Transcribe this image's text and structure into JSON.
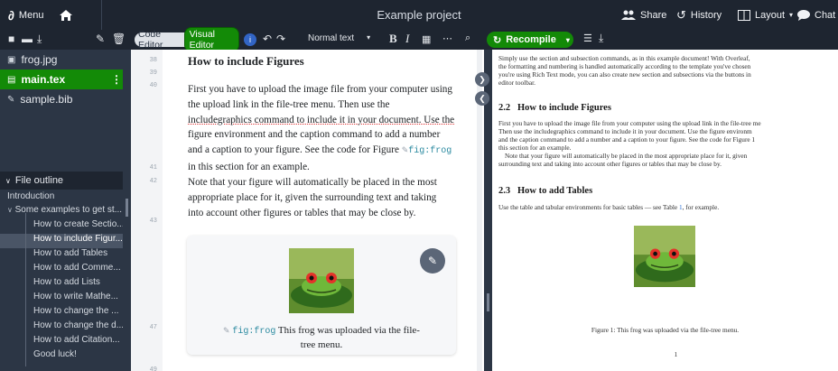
{
  "topbar": {
    "menu_label": "Menu",
    "project_title": "Example project",
    "share_label": "Share",
    "history_label": "History",
    "layout_label": "Layout",
    "chat_label": "Chat"
  },
  "files": [
    {
      "name": "frog.jpg",
      "icon": "image-icon"
    },
    {
      "name": "main.tex",
      "icon": "file-icon"
    },
    {
      "name": "sample.bib",
      "icon": "bib-icon"
    }
  ],
  "outline": {
    "title": "File outline",
    "items": [
      "Introduction",
      "Some examples to get st...",
      "How to create Sectio...",
      "How to include Figur...",
      "How to add Tables",
      "How to add Comme...",
      "How to add Lists",
      "How to write Mathe...",
      "How to change the ...",
      "How to change the d...",
      "How to add Citation...",
      "Good luck!"
    ]
  },
  "editor": {
    "code_editor_label": "Code Editor",
    "visual_editor_label": "Visual Editor",
    "style_select": "Normal text",
    "line_numbers": [
      "38",
      "39",
      "40",
      "41",
      "42",
      "43",
      "47",
      "49"
    ],
    "heading": "How to include Figures",
    "para1_l1": "First you have to upload the image file from your computer using",
    "para1_l2": "the upload link in the file-tree menu. Then use the",
    "para1_l3": "includegraphics command to include it in your document. Use the",
    "para1_l4": "figure environment and the caption command to add a number",
    "para1_l5": "and a caption to your figure. See the code for Figure",
    "para1_ref": "fig:frog",
    "para1_l6": "in this section for an example.",
    "para2_l1": "Note that your figure will automatically be placed in the most",
    "para2_l2": "appropriate place for it, given the surrounding text and taking",
    "para2_l3": "into account other figures or tables that may be close by.",
    "fig_label": "fig:frog",
    "fig_caption_l1": "This frog was uploaded via the file-",
    "fig_caption_l2": "tree menu."
  },
  "pdf": {
    "recompile_label": "Recompile",
    "intro_l1": "Simply use the section and subsection commands, as in this example document! With Overleaf,",
    "intro_l2": "the formatting and numbering is handled automatically according to the template you've chosen",
    "intro_l3": "you're using Rich Text mode, you can also create new section and subsections via the buttons in",
    "intro_l4": "editor toolbar.",
    "sec22_num": "2.2",
    "sec22_title": "How to include Figures",
    "p22_l1": "First you have to upload the image file from your computer using the upload link in the file-tree me",
    "p22_l2": "Then use the includegraphics command to include it in your document. Use the figure environm",
    "p22_l3": "and the caption command to add a number and a caption to your figure. See the code for Figure 1",
    "p22_l4": "this section for an example.",
    "p22_l5": "Note that your figure will automatically be placed in the most appropriate place for it, given",
    "p22_l6": "surrounding text and taking into account other figures or tables that may be close by.",
    "sec23_num": "2.3",
    "sec23_title": "How to add Tables",
    "p23_pre": "Use the table and tabular environments for basic tables — see Table",
    "p23_ref": "1",
    "p23_post": ", for example.",
    "figure_caption": "Figure 1: This frog was uploaded via the file-tree menu.",
    "page_number": "1"
  },
  "colors": {
    "accent_green": "#138a07",
    "dark_bar": "#1e2530",
    "panel": "#2c3645",
    "link_blue": "#2b6fd6"
  }
}
